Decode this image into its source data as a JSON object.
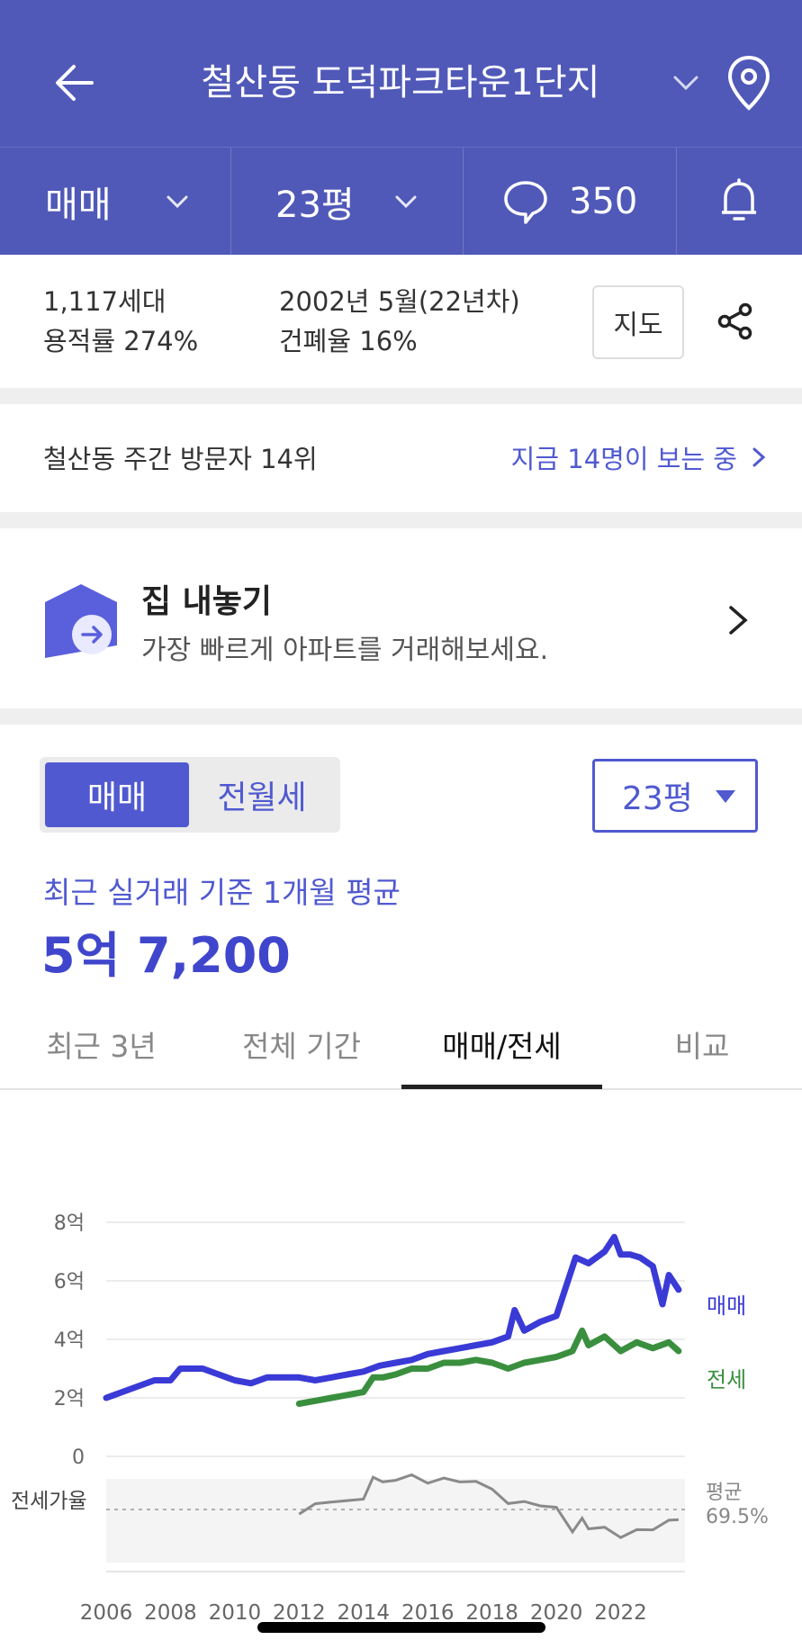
{
  "header": {
    "title": "철산동 도덕파크타운1단지",
    "icons": {
      "back": "back-arrow-icon",
      "dropdown": "chevron-down-icon",
      "location": "map-pin-icon"
    }
  },
  "subbar": {
    "deal_type": "매매",
    "size": "23평",
    "comment_count": "350",
    "icons": {
      "comment": "speech-bubble-icon",
      "alert": "bell-icon"
    }
  },
  "info": {
    "households": "1,117세대",
    "floor_area_ratio": "용적률 274%",
    "built": "2002년 5월(22년차)",
    "building_coverage": "건폐율 16%",
    "map_button": "지도",
    "share_icon": "share-icon"
  },
  "visitors": {
    "rank": "철산동 주간 방문자 14위",
    "now_viewing": "지금 14명이 보는 중"
  },
  "sell_banner": {
    "title": "집 내놓기",
    "subtitle": "가장 빠르게 아파트를 거래해보세요."
  },
  "price": {
    "toggle": [
      "매매",
      "전월세"
    ],
    "size_select": "23평",
    "avg_label": "최근 실거래 기준 1개월 평균",
    "avg_value": "5억 7,200"
  },
  "tabs": [
    "최근 3년",
    "전체 기간",
    "매매/전세",
    "비교"
  ],
  "active_tab": 2,
  "chart_data": {
    "type": "line",
    "yticks": [
      "8억",
      "6억",
      "4억",
      "2억",
      "0"
    ],
    "xticks": [
      "2006",
      "2008",
      "2010",
      "2012",
      "2014",
      "2016",
      "2018",
      "2020",
      "2022"
    ],
    "ylim": [
      0,
      8
    ],
    "xlim": [
      2006,
      2024
    ],
    "colors": {
      "sale": "#3a3ad6",
      "jeonse": "#3a8f3f",
      "ratio": "#8a8a8a"
    },
    "series": [
      {
        "name": "매매",
        "x": [
          2006,
          2006.5,
          2007,
          2007.5,
          2008,
          2008.3,
          2009,
          2009.5,
          2010,
          2010.5,
          2011,
          2011.5,
          2012,
          2012.5,
          2013,
          2013.5,
          2014,
          2014.5,
          2015,
          2015.5,
          2016,
          2016.5,
          2017,
          2017.5,
          2018,
          2018.5,
          2018.7,
          2019,
          2019.5,
          2020,
          2020.3,
          2020.6,
          2021,
          2021.5,
          2021.8,
          2022,
          2022.3,
          2022.6,
          2023,
          2023.3,
          2023.5,
          2023.8
        ],
        "values": [
          2.0,
          2.2,
          2.4,
          2.6,
          2.6,
          3.0,
          3.0,
          2.8,
          2.6,
          2.5,
          2.7,
          2.7,
          2.7,
          2.6,
          2.7,
          2.8,
          2.9,
          3.1,
          3.2,
          3.3,
          3.5,
          3.6,
          3.7,
          3.8,
          3.9,
          4.1,
          5.0,
          4.3,
          4.6,
          4.8,
          5.8,
          6.8,
          6.6,
          7.0,
          7.5,
          6.9,
          6.9,
          6.8,
          6.5,
          5.2,
          6.2,
          5.7
        ]
      },
      {
        "name": "전세",
        "x": [
          2012,
          2012.5,
          2013,
          2013.5,
          2014,
          2014.3,
          2014.6,
          2015,
          2015.5,
          2016,
          2016.5,
          2017,
          2017.5,
          2018,
          2018.5,
          2019,
          2019.5,
          2020,
          2020.5,
          2020.8,
          2021,
          2021.5,
          2022,
          2022.5,
          2023,
          2023.5,
          2023.8
        ],
        "values": [
          1.8,
          1.9,
          2.0,
          2.1,
          2.2,
          2.7,
          2.7,
          2.8,
          3.0,
          3.0,
          3.2,
          3.2,
          3.3,
          3.2,
          3.0,
          3.2,
          3.3,
          3.4,
          3.6,
          4.3,
          3.8,
          4.1,
          3.6,
          3.9,
          3.7,
          3.9,
          3.6
        ]
      }
    ],
    "ratio": {
      "label": "전세가율",
      "avg_label": "평균",
      "avg_value": "69.5%"
    }
  }
}
